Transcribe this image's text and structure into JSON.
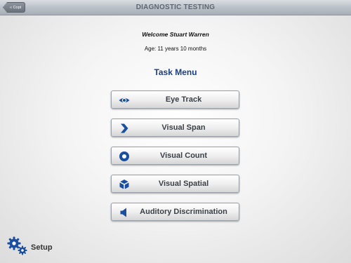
{
  "header": {
    "back_label": "« Copt",
    "title": "DIAGNOSTIC TESTING"
  },
  "user": {
    "welcome": "Welcome Stuart Warren",
    "age": "Age: 11 years 10 months"
  },
  "menu": {
    "heading": "Task Menu",
    "items": [
      {
        "label": "Eye Track",
        "icon": "eye-icon"
      },
      {
        "label": "Visual Span",
        "icon": "chevron-right-icon"
      },
      {
        "label": "Visual Count",
        "icon": "circle-icon"
      },
      {
        "label": "Visual Spatial",
        "icon": "cube-icon"
      },
      {
        "label": "Auditory Discrimination",
        "icon": "speaker-icon"
      }
    ]
  },
  "footer": {
    "setup_label": "Setup",
    "setup_icon": "gears-icon"
  },
  "colors": {
    "accent": "#1a4fa0",
    "heading": "#1a3f86"
  }
}
